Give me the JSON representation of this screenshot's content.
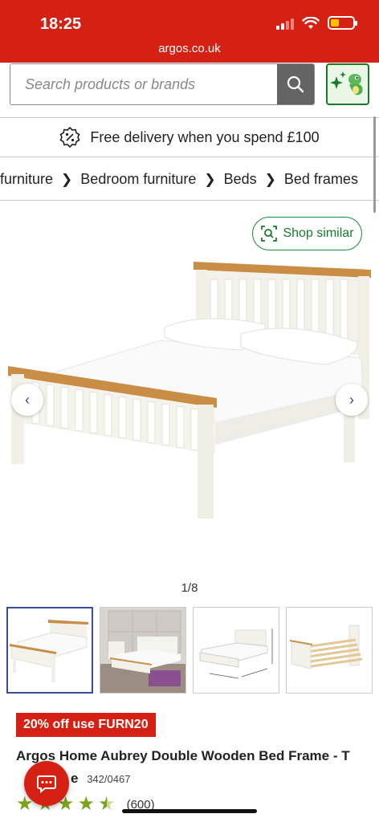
{
  "status_bar": {
    "time": "18:25",
    "url": "argos.co.uk"
  },
  "search": {
    "placeholder": "Search products or brands"
  },
  "delivery_banner": {
    "text": "Free delivery when you spend £100"
  },
  "breadcrumb": [
    {
      "label": "furniture"
    },
    {
      "label": "Bedroom furniture"
    },
    {
      "label": "Beds"
    },
    {
      "label": "Bed frames"
    }
  ],
  "gallery": {
    "shop_similar_label": "Shop similar",
    "pager": "1/8"
  },
  "product": {
    "offer": "20% off use FURN20",
    "title": "Argos Home Aubrey Double Wooden Bed Frame - T",
    "title_cont": "e",
    "sku": "342/0467",
    "rating": 4.5,
    "review_count": "(600)"
  },
  "colors": {
    "brand_red": "#d42114",
    "green": "#1a7a2c",
    "star_green": "#7aa31a"
  },
  "icons": [
    "search-icon",
    "ai-assistant-icon",
    "delivery-badge-icon",
    "chevron-right-icon",
    "shop-similar-icon",
    "chevron-left-icon",
    "chat-icon"
  ]
}
